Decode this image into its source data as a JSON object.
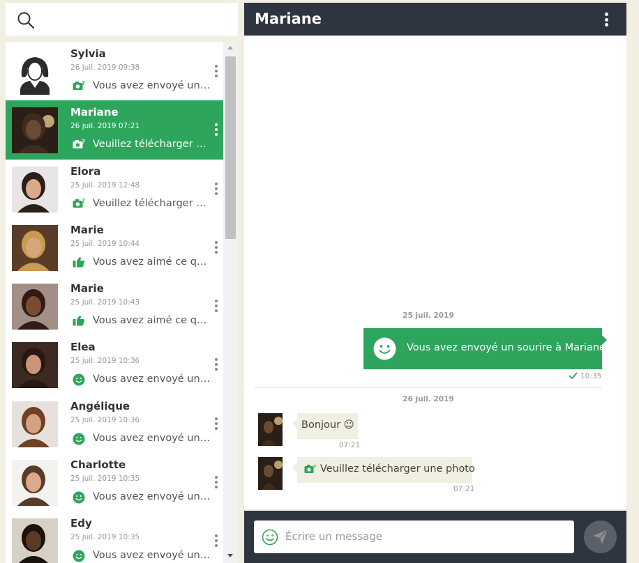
{
  "search": {
    "placeholder": "",
    "value": ""
  },
  "conversations": [
    {
      "name": "Sylvia",
      "date": "26 juil. 2019 09:38",
      "icon": "camera-icon",
      "message": "Vous avez envoyé une demande de photo",
      "active": false
    },
    {
      "name": "Mariane",
      "date": "26 juil. 2019 07:21",
      "icon": "camera-icon",
      "message": "Veuillez télécharger une photo",
      "active": true
    },
    {
      "name": "Elora",
      "date": "25 juil. 2019 12:48",
      "icon": "camera-icon",
      "message": "Veuillez télécharger une photo",
      "active": false
    },
    {
      "name": "Marie",
      "date": "25 juil. 2019 10:44",
      "icon": "thumbs-up-icon",
      "message": "Vous avez aimé ce qu'elle a posté",
      "active": false
    },
    {
      "name": "Marie",
      "date": "25 juil. 2019 10:43",
      "icon": "thumbs-up-icon",
      "message": "Vous avez aimé ce qu'elle a posté",
      "active": false
    },
    {
      "name": "Elea",
      "date": "25 juil. 2019 10:36",
      "icon": "smiley-icon",
      "message": "Vous avez envoyé un sourire",
      "active": false
    },
    {
      "name": "Angélique",
      "date": "25 juil. 2019 10:36",
      "icon": "smiley-icon",
      "message": "Vous avez envoyé un sourire",
      "active": false
    },
    {
      "name": "Charlotte",
      "date": "25 juil. 2019 10:35",
      "icon": "smiley-icon",
      "message": "Vous avez envoyé un sourire",
      "active": false
    },
    {
      "name": "Edy",
      "date": "25 juil. 2019 10:35",
      "icon": "smiley-icon",
      "message": "Vous avez envoyé un sourire",
      "active": false
    }
  ],
  "chat": {
    "title": "Mariane",
    "date_1": "25 juil. 2019",
    "sent_message": "Vous avez envoyé un sourire à Mariane",
    "sent_time": "10:35",
    "date_2": "26 juil. 2019",
    "recv_1_text": "Bonjour ☺",
    "recv_1_time": "07:21",
    "recv_2_text": "Veuillez télécharger une photo",
    "recv_2_time": "07:21"
  },
  "composer": {
    "placeholder": "Écrire un message"
  },
  "colors": {
    "accent": "#2ea55c",
    "header": "#2e3440",
    "background": "#f1eee2"
  }
}
